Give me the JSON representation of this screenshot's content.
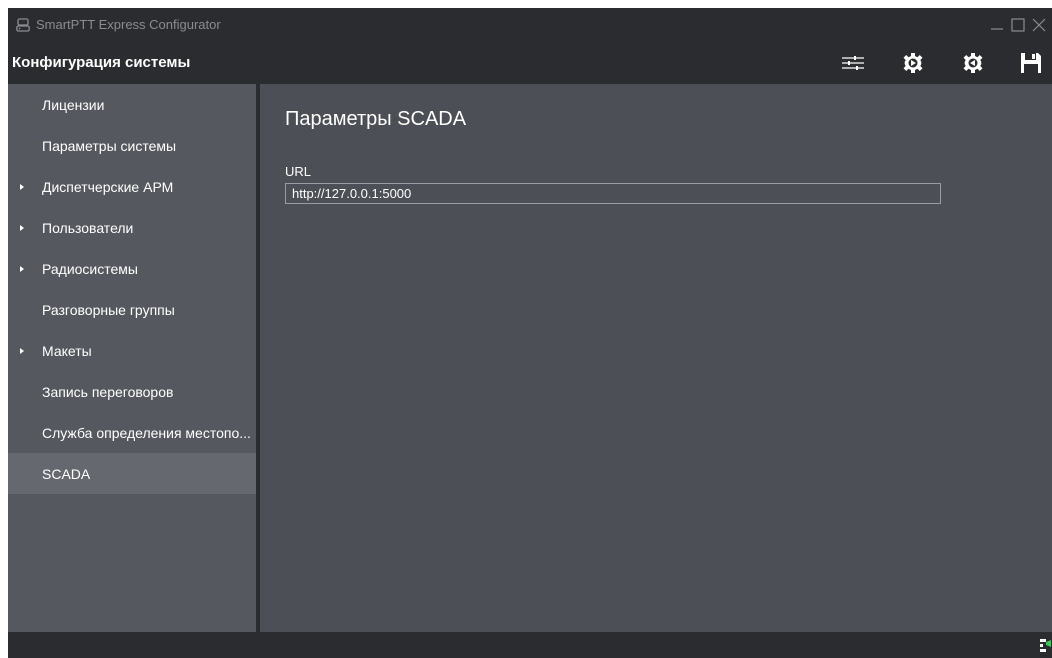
{
  "window": {
    "title": "SmartPTT Express Configurator",
    "icons": {
      "app": "app-icon",
      "minimize": "minimize-icon",
      "maximize": "maximize-icon",
      "close": "close-icon"
    }
  },
  "header": {
    "title": "Конфигурация системы",
    "toolbar": [
      {
        "name": "settings-sliders-icon"
      },
      {
        "name": "export-config-icon"
      },
      {
        "name": "import-config-icon"
      },
      {
        "name": "save-icon"
      }
    ]
  },
  "sidebar": {
    "items": [
      {
        "label": "Лицензии",
        "expandable": false,
        "active": false
      },
      {
        "label": "Параметры системы",
        "expandable": false,
        "active": false
      },
      {
        "label": "Диспетчерские АРМ",
        "expandable": true,
        "active": false
      },
      {
        "label": "Пользователи",
        "expandable": true,
        "active": false
      },
      {
        "label": "Радиосистемы",
        "expandable": true,
        "active": false
      },
      {
        "label": "Разговорные группы",
        "expandable": false,
        "active": false
      },
      {
        "label": "Макеты",
        "expandable": true,
        "active": false
      },
      {
        "label": "Запись переговоров",
        "expandable": false,
        "active": false
      },
      {
        "label": "Служба определения местопо...",
        "expandable": false,
        "active": false
      },
      {
        "label": "SCADA",
        "expandable": false,
        "active": true
      }
    ]
  },
  "main": {
    "title": "Параметры SCADA",
    "url_label": "URL",
    "url_value": "http://127.0.0.1:5000"
  },
  "colors": {
    "chrome": "#2b2c30",
    "sidebar": "#56585f",
    "sidebar_active": "#66686f",
    "content": "#4d4f56",
    "status_accent": "#3cc85a"
  }
}
